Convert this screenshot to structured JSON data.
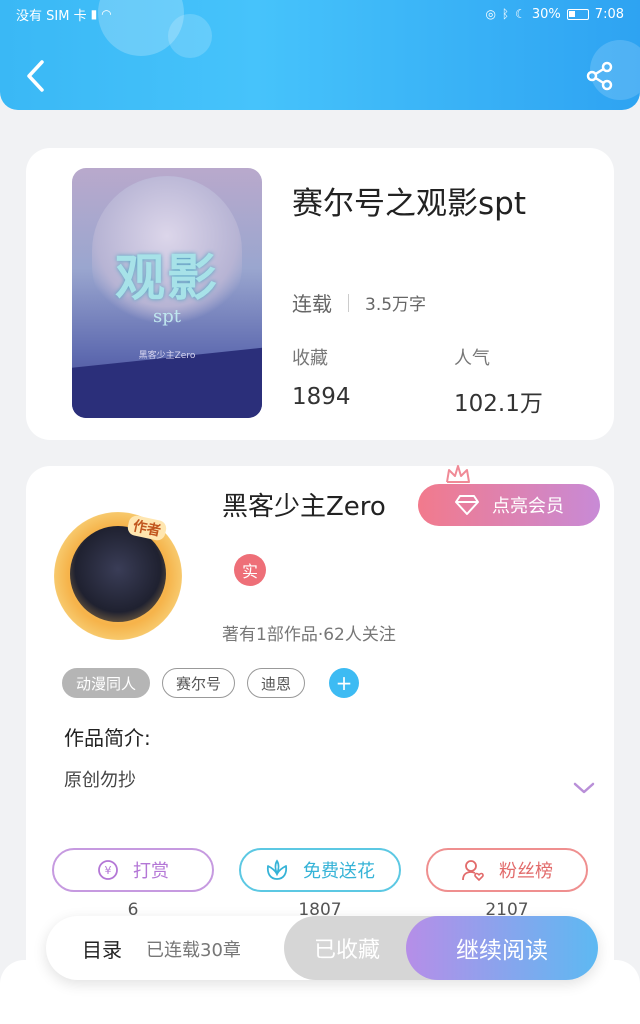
{
  "status_bar": {
    "carrier": "没有 SIM 卡",
    "battery": "30%",
    "time": "7:08"
  },
  "header": {
    "back_icon": "chevron-left-icon",
    "share_icon": "share-icon"
  },
  "book": {
    "title": "赛尔号之观影spt",
    "cover_title": "观影",
    "cover_sub": "spt",
    "cover_author": "黑客少主Zero",
    "status": "连载",
    "word_count": "3.5万字",
    "favorites_label": "收藏",
    "favorites_value": "1894",
    "popularity_label": "人气",
    "popularity_value": "102.1万"
  },
  "author": {
    "name": "黑客少主Zero",
    "avatar_badge": "作者",
    "vip_label": "点亮会员",
    "real_badge": "实",
    "works_info": "著有1部作品·62人关注",
    "tags": [
      "动漫同人",
      "赛尔号",
      "迪恩"
    ],
    "add_tag_label": "+",
    "intro_title": "作品简介:",
    "intro_text": "原创勿抄"
  },
  "actions": {
    "reward_label": "打赏",
    "reward_count": "6",
    "flower_label": "免费送花",
    "flower_count": "1807",
    "fans_label": "粉丝榜",
    "fans_count": "2107"
  },
  "bottom_bar": {
    "toc_label": "目录",
    "toc_count": "已连载30章",
    "favorited_label": "已收藏",
    "continue_label": "继续阅读"
  },
  "colors": {
    "header_gradient_start": "#3ab8f5",
    "header_gradient_end": "#2ea3f2",
    "vip_gradient_start": "#f27a8c",
    "vip_gradient_end": "#c88ad6",
    "read_gradient_start": "#b68ee8",
    "read_gradient_end": "#5db9f2"
  }
}
